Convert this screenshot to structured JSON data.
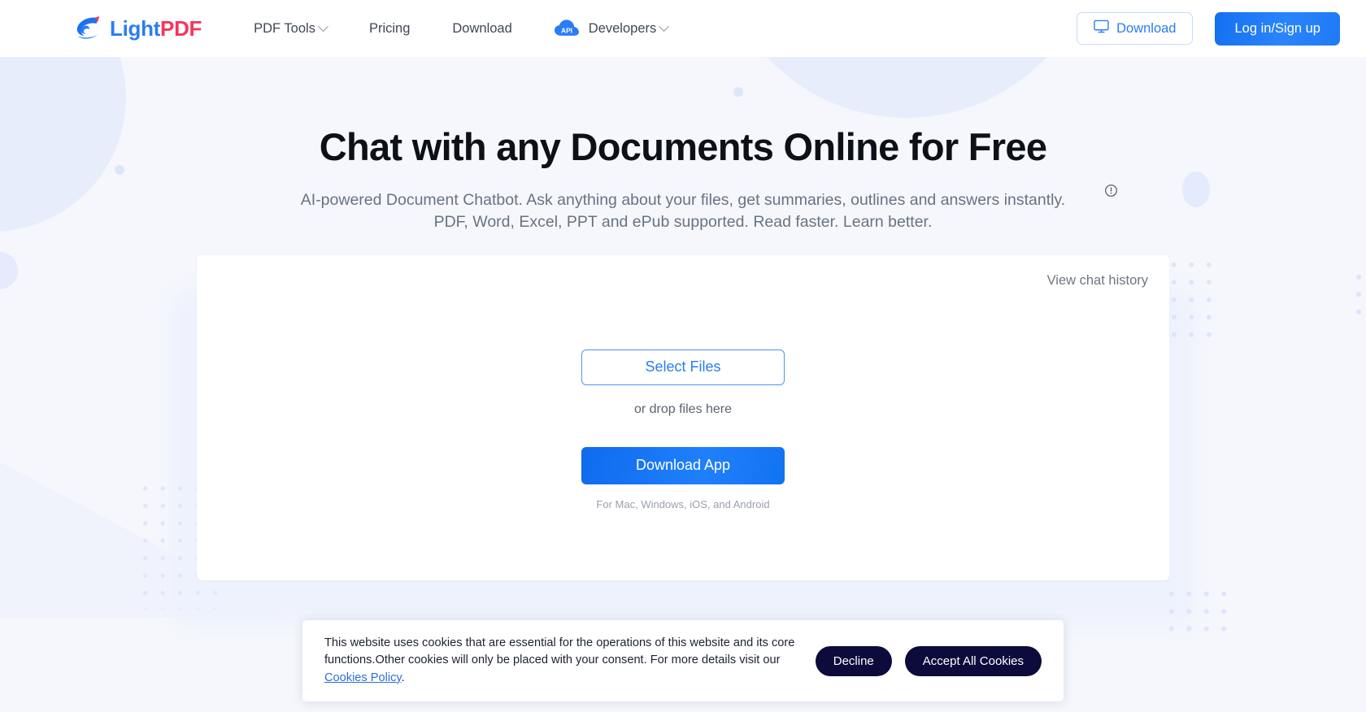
{
  "header": {
    "logo": {
      "icon": "lightpdf-bird-logo",
      "text_light": "Light",
      "text_pdf": "PDF"
    },
    "nav": [
      {
        "label": "PDF Tools",
        "has_dropdown": true,
        "icon": ""
      },
      {
        "label": "Pricing",
        "has_dropdown": false,
        "icon": ""
      },
      {
        "label": "Download",
        "has_dropdown": false,
        "icon": ""
      },
      {
        "label": "Developers",
        "has_dropdown": true,
        "icon": "api-cloud-icon",
        "badge": "API"
      }
    ],
    "download_button": {
      "label": "Download",
      "icon": "monitor-icon"
    },
    "login_button": {
      "label": "Log in/Sign up"
    }
  },
  "hero": {
    "title": "Chat with any Documents Online for Free",
    "subtitle_line1": "AI-powered Document Chatbot. Ask anything about your files, get summaries, outlines and answers instantly.",
    "subtitle_line2": "PDF, Word, Excel, PPT and ePub supported. Read faster. Learn better.",
    "info_icon": "exclamation-circle-icon"
  },
  "card": {
    "view_history_label": "View chat history",
    "select_files_label": "Select Files",
    "drop_hint": "or drop files here",
    "download_app_label": "Download App",
    "download_caption": "For Mac, Windows, iOS, and Android"
  },
  "cookie_banner": {
    "text_part1": "This website uses cookies that are essential for the operations of this website and its core functions.Other cookies will only be placed with your consent. For more details visit our ",
    "link_label": "Cookies Policy",
    "text_part2": ".",
    "decline_label": "Decline",
    "accept_label": "Accept All Cookies"
  },
  "colors": {
    "brand_blue": "#2a7df4",
    "brand_red": "#f4365c",
    "page_bg": "#f5f7fd",
    "cookie_button": "#0d0b3c",
    "accent_soft": "#e7edfb"
  }
}
